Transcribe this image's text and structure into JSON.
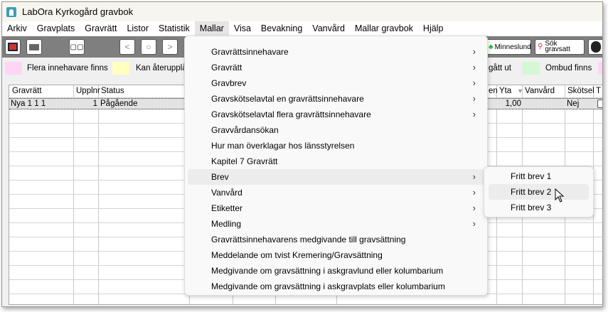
{
  "window": {
    "title": "LabOra Kyrkogård gravbok"
  },
  "menubar": [
    "Arkiv",
    "Gravplats",
    "Gravrätt",
    "Listor",
    "Statistik",
    "Mallar",
    "Visa",
    "Bevakning",
    "Vanvård",
    "Mallar gravbok",
    "Hjälp"
  ],
  "toolbar": {
    "minneslund": "Minneslund",
    "sok1": "Sök",
    "sok2": "gravsatt"
  },
  "legend": [
    {
      "label": "Flera innehavare finns",
      "color": "#ffd5f5"
    },
    {
      "label": "Kan återupplå",
      "color": "#ffffc0"
    },
    {
      "label": "r gått ut",
      "color": ""
    },
    {
      "label": "Ombud finns",
      "color": "#d4f7d4"
    }
  ],
  "table": {
    "headers_left": [
      "Gravrätt",
      "Upplnr",
      "Status"
    ],
    "headers_right": [
      "en",
      "Yta",
      "Vanvård",
      "Skötsel",
      "T"
    ],
    "row": {
      "gravratt": "Nya 1 1 1",
      "upplnr": "1",
      "status": "Pågående",
      "yta": "1,00",
      "skotsel": "Nej"
    }
  },
  "menu": {
    "items": [
      {
        "label": "Gravrättsinnehavare",
        "sub": true
      },
      {
        "label": "Gravrätt",
        "sub": true
      },
      {
        "label": "Gravbrev",
        "sub": true
      },
      {
        "label": "Gravskötselavtal en gravrättsinnehavare",
        "sub": true
      },
      {
        "label": "Gravskötselavtal flera gravrättsinnehavare",
        "sub": true
      },
      {
        "label": "Gravvårdansökan",
        "sub": false
      },
      {
        "label": "Hur man överklagar hos länsstyrelsen",
        "sub": false
      },
      {
        "label": "Kapitel 7 Gravrätt",
        "sub": false
      },
      {
        "label": "Brev",
        "sub": true,
        "highlighted": true
      },
      {
        "label": "Vanvård",
        "sub": true
      },
      {
        "label": "Etiketter",
        "sub": true
      },
      {
        "label": "Medling",
        "sub": true
      },
      {
        "label": "Gravrättsinnehavarens medgivande till gravsättning",
        "sub": false
      },
      {
        "label": "Meddelande om tvist Kremering/Gravsättning",
        "sub": false
      },
      {
        "label": "Medgivande om gravsättning i askgravlund eller kolumbarium",
        "sub": false
      },
      {
        "label": "Medgivande om gravsättning i askgravplats eller kolumbarium",
        "sub": false
      }
    ]
  },
  "submenu": {
    "items": [
      "Fritt brev 1",
      "Fritt brev 2",
      "Fritt brev 3"
    ],
    "highlighted": 1
  }
}
